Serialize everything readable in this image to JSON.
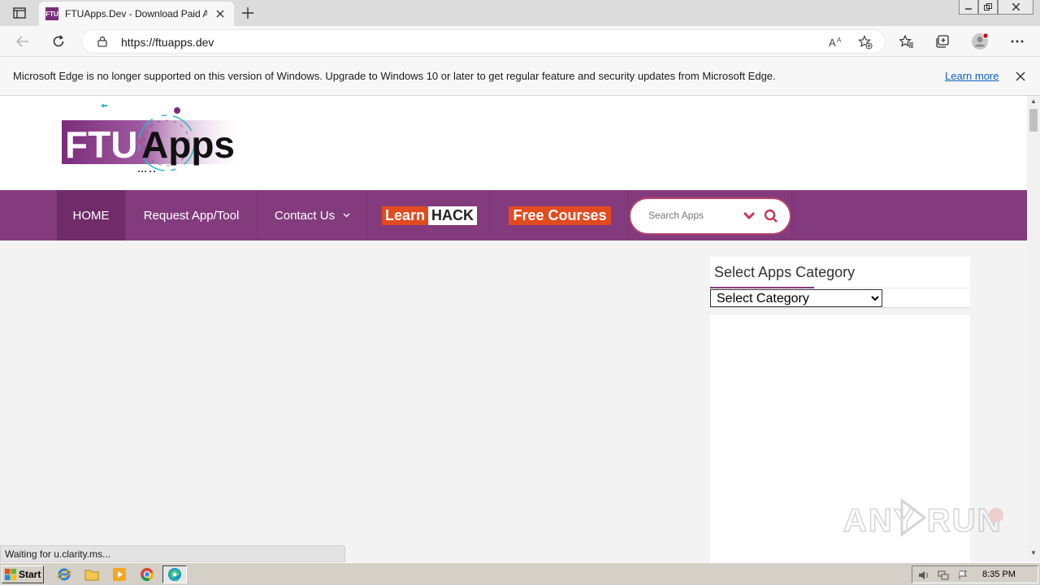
{
  "browser": {
    "tab_favicon_text": "FTU",
    "tab_title": "FTUApps.Dev - Download Paid Apps",
    "url": "https://ftuapps.dev",
    "infobar_message": "Microsoft Edge is no longer supported on this version of Windows. Upgrade to Windows 10 or later to get regular feature and security updates from Microsoft Edge.",
    "infobar_link": "Learn more",
    "status_text": "Waiting for u.clarity.ms...",
    "icons": {
      "tab_actions": "tab-actions-icon",
      "close_tab": "close-icon",
      "new_tab": "plus-icon",
      "back": "back-arrow-icon",
      "refresh": "refresh-icon",
      "lock": "lock-icon",
      "read_aloud": "read-aloud-icon",
      "add_favorite": "star-add-icon",
      "favorites": "favorites-icon",
      "collections": "collections-icon",
      "profile": "profile-icon",
      "more": "more-icon"
    }
  },
  "site": {
    "logo": {
      "text_left": "FTU",
      "text_right": "Apps"
    },
    "menu": {
      "home": "HOME",
      "request": "Request App/Tool",
      "contact": "Contact Us",
      "learn_a": "Learn",
      "learn_b": "HACK",
      "free_courses": "Free Courses"
    },
    "search": {
      "placeholder": "Search Apps"
    },
    "sidebar": {
      "title": "Select Apps Category",
      "select_value": "Select Category"
    },
    "colors": {
      "menu": "#843b7e",
      "menu_active": "#6f2c69",
      "accent": "#e24a1f"
    }
  },
  "watermark": {
    "text": "ANY RUN"
  },
  "taskbar": {
    "start_label": "Start",
    "clock": "8:35 PM",
    "pinned": [
      "internet-explorer-icon",
      "folder-icon",
      "media-player-icon",
      "chrome-icon",
      "edge-icon"
    ]
  }
}
